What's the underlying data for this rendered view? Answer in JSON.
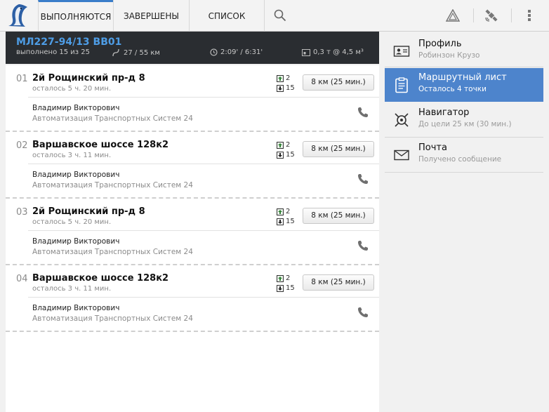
{
  "tabs": [
    {
      "label": "ВЫПОЛНЯЮТСЯ"
    },
    {
      "label": "ЗАВЕРШЕНЫ"
    },
    {
      "label": "СПИСОК ЛИСТОВ"
    }
  ],
  "toolbar_icons": [
    "penguin-logo-icon",
    "search-icon",
    "warning-triangle-icon",
    "satellite-icon",
    "overflow-menu-icon"
  ],
  "route": {
    "id": "МЛ227-94/13 BB01",
    "done": "выполнено 15 из 25",
    "distance": "27 / 55 км",
    "time": "2:09' / 6:31'",
    "load": "0,3 т @ 4,5 м³"
  },
  "stops": [
    {
      "num": "01",
      "address": "2й Рощинский пр-д 8",
      "remain": "осталось 5 ч. 20 мин.",
      "load_count": "2",
      "unload_count": "15",
      "distance": "8 км (25 мин.)",
      "person": "Владимир Викторович",
      "company": "Автоматизация Транспортных Систем 24"
    },
    {
      "num": "02",
      "address": "Варшавское шоссе 128к2",
      "remain": "осталось 3 ч. 11 мин.",
      "load_count": "2",
      "unload_count": "15",
      "distance": "8 км (25 мин.)",
      "person": "Владимир Викторович",
      "company": "Автоматизация Транспортных Систем 24"
    },
    {
      "num": "03",
      "address": "2й Рощинский пр-д 8",
      "remain": "осталось 5 ч. 20 мин.",
      "load_count": "2",
      "unload_count": "15",
      "distance": "8 км (25 мин.)",
      "person": "Владимир Викторович",
      "company": "Автоматизация Транспортных Систем 24"
    },
    {
      "num": "04",
      "address": "Варшавское шоссе 128к2",
      "remain": "осталось 3 ч. 11 мин.",
      "load_count": "2",
      "unload_count": "15",
      "distance": "8 км (25 мин.)",
      "person": "Владимир Викторович",
      "company": "Автоматизация Транспортных Систем 24"
    }
  ],
  "menu": [
    {
      "title": "Профиль",
      "sub": "Робинзон Крузо",
      "icon": "id-card-icon"
    },
    {
      "title": "Маршрутный лист",
      "sub": "Осталось 4 точки",
      "icon": "clipboard-icon",
      "active": true
    },
    {
      "title": "Навигатор",
      "sub": "До цели 25 км (30 мин.)",
      "icon": "crosshair-icon"
    },
    {
      "title": "Почта",
      "sub": "Получено сообщение",
      "icon": "envelope-icon"
    }
  ],
  "colors": {
    "accent": "#4d84cc",
    "route_id": "#4e9de6",
    "header_bg": "#2a2d31",
    "tab_active": "#3a7dc9"
  }
}
